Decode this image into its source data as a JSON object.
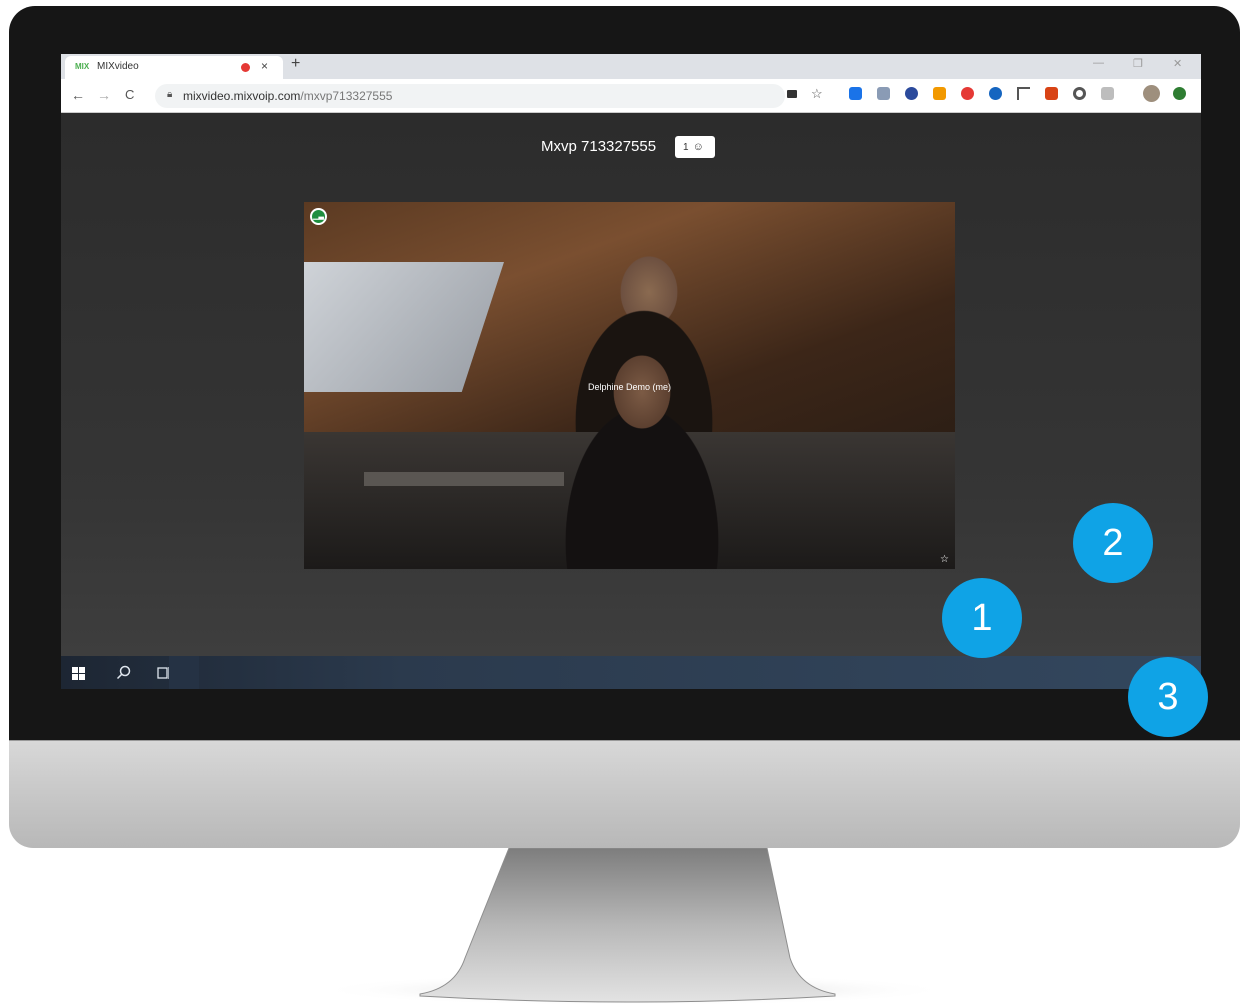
{
  "browser": {
    "tab_favicon": "MIX",
    "tab_title": "MIXvideo",
    "tab_close": "×",
    "new_tab": "+",
    "url_host": "mixvideo.mixvoip.com",
    "url_path": "/mxvp713327555",
    "nav_back": "←",
    "nav_forward": "→",
    "nav_reload": "C",
    "bookmark_star": "☆",
    "minimize": "—",
    "restore": "❐",
    "close": "✕"
  },
  "meeting": {
    "room_title": "Mxvp 713327555",
    "participant_count": "1",
    "participant_name": "Delphine Demo (me)"
  },
  "callouts": {
    "one": "1",
    "two": "2",
    "three": "3"
  },
  "colors": {
    "accent_blue": "#0fa3e6",
    "hangup_red": "#d32f2f",
    "signal_green": "#1e8e3e"
  }
}
